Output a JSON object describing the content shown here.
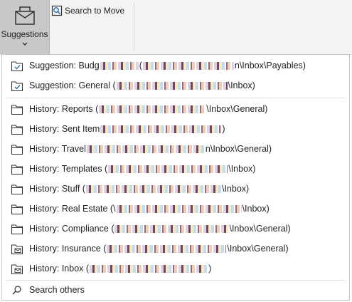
{
  "ribbon": {
    "suggestions_label": "Suggestions",
    "search_to_move_label": "Search to Move"
  },
  "menu": {
    "suggestions": [
      {
        "prefix": "Suggestion: Budg",
        "middle": " (",
        "suffix": "n\\Inbox\\Payables)",
        "icon": "folder-suggestion-icon"
      },
      {
        "prefix": "Suggestion: General (",
        "middle": "",
        "suffix": "\\Inbox)",
        "icon": "folder-suggestion-icon"
      }
    ],
    "history": [
      {
        "prefix": "History: Reports (",
        "suffix": "\\Inbox\\General)",
        "icon": "folder-icon"
      },
      {
        "prefix": "History: Sent Item",
        "suffix": ")",
        "icon": "folder-icon"
      },
      {
        "prefix": "History: Travel ",
        "suffix": "n\\Inbox\\General)",
        "icon": "folder-icon"
      },
      {
        "prefix": "History: Templates (",
        "suffix": "\\Inbox)",
        "icon": "folder-icon"
      },
      {
        "prefix": "History: Stuff (",
        "suffix": "\\Inbox)",
        "icon": "folder-icon"
      },
      {
        "prefix": "History: Real Estate (\\",
        "suffix": "\\Inbox)",
        "icon": "folder-icon"
      },
      {
        "prefix": "History: Compliance (",
        "suffix": "\\Inbox\\General)",
        "icon": "folder-icon"
      },
      {
        "prefix": "History: Insurance (",
        "suffix": "\\Inbox\\General)",
        "icon": "mail-folder-icon"
      },
      {
        "prefix": "History: Inbox (",
        "suffix": ")",
        "icon": "mail-folder-icon"
      }
    ],
    "search_others_label": "Search others"
  }
}
